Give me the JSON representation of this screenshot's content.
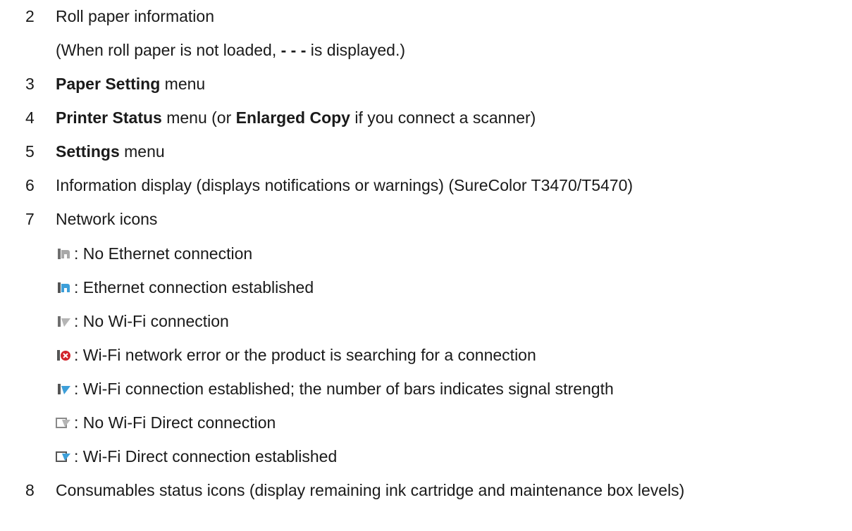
{
  "items": [
    {
      "num": "2",
      "text": "Roll paper information"
    },
    {
      "sub_pre": "(When roll paper is not loaded, ",
      "sub_bold": "- - -",
      "sub_post": " is displayed.)"
    },
    {
      "num": "3",
      "bold": "Paper Setting",
      "post": " menu"
    },
    {
      "num": "4",
      "bold": "Printer Status",
      "mid": " menu (or ",
      "bold2": "Enlarged Copy",
      "post": " if you connect a scanner)"
    },
    {
      "num": "5",
      "bold": "Settings",
      "post": " menu"
    },
    {
      "num": "6",
      "text": "Information display (displays notifications or warnings) (SureColor T3470/T5470)"
    },
    {
      "num": "7",
      "text": "Network icons"
    },
    {
      "num": "8",
      "text": "Consumables status icons (display remaining ink cartridge and maintenance box levels)"
    }
  ],
  "network_icons": [
    {
      "icon": "ethernet-off-icon",
      "text": ": No Ethernet connection"
    },
    {
      "icon": "ethernet-on-icon",
      "text": ": Ethernet connection established"
    },
    {
      "icon": "wifi-off-icon",
      "text": ": No Wi-Fi connection"
    },
    {
      "icon": "wifi-error-icon",
      "text": ": Wi-Fi network error or the product is searching for a connection"
    },
    {
      "icon": "wifi-on-icon",
      "text": ": Wi-Fi connection established; the number of bars indicates signal strength"
    },
    {
      "icon": "wifi-direct-off-icon",
      "text": ": No Wi-Fi Direct connection"
    },
    {
      "icon": "wifi-direct-on-icon",
      "text": ": Wi-Fi Direct connection established"
    }
  ],
  "colors": {
    "text": "#1a1a1a",
    "icon_gray": "#9a9a9a",
    "icon_blue": "#3d9fd9",
    "icon_red": "#d2232a"
  }
}
